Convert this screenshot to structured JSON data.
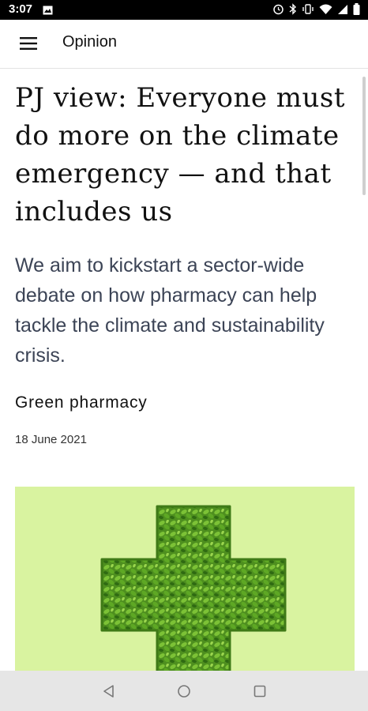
{
  "status_bar": {
    "time": "3:07",
    "icons": [
      "image-icon",
      "alarm-icon",
      "bluetooth-icon",
      "vibrate-icon",
      "wifi-icon",
      "signal-icon",
      "battery-icon"
    ]
  },
  "app_bar": {
    "menu_icon": "hamburger-menu-icon",
    "title": "Opinion"
  },
  "article": {
    "headline": "PJ view: Everyone must do more on the climate emergency — and that includes us",
    "standfirst": "We aim to kickstart a sector-wide debate on how pharmacy can help tackle the climate and sustainability crisis.",
    "category": "Green pharmacy",
    "date": "18 June 2021",
    "image": {
      "subject": "green leafy cross",
      "background_color": "#d9f3a0",
      "leaf_color": "#4e8f1f"
    }
  },
  "nav_bar": {
    "buttons": [
      "back-icon",
      "home-icon",
      "recents-icon"
    ]
  },
  "colors": {
    "status_bar_bg": "#000000",
    "nav_bar_bg": "#e6e6e6",
    "standfirst_text": "#3c4456"
  }
}
